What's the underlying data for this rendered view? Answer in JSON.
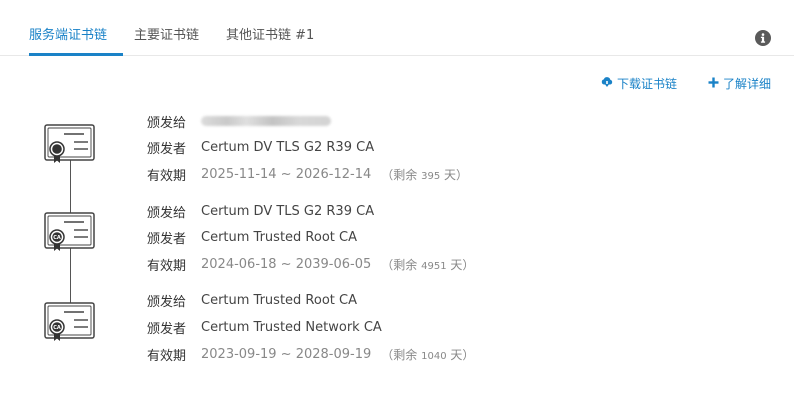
{
  "tabs": [
    {
      "label": "服务端证书链",
      "active": true
    },
    {
      "label": "主要证书链",
      "active": false
    },
    {
      "label": "其他证书链 #1",
      "active": false
    }
  ],
  "actions": {
    "download": "下载证书链",
    "details": "了解详细"
  },
  "labels": {
    "issued_to": "颁发给",
    "issuer": "颁发者",
    "validity": "有效期",
    "remaining_prefix": "（剩余",
    "remaining_suffix": "天）"
  },
  "certificates": [
    {
      "issued_to": "",
      "issued_to_redacted": true,
      "issuer": "Certum DV TLS G2 R39 CA",
      "validity": "2025-11-14 ~ 2026-12-14",
      "remaining_days": "395",
      "icon": "certificate-seal-icon"
    },
    {
      "issued_to": "Certum DV TLS G2 R39 CA",
      "issuer": "Certum Trusted Root CA",
      "validity": "2024-06-18 ~ 2039-06-05",
      "remaining_days": "4951",
      "icon": "certificate-ca-icon"
    },
    {
      "issued_to": "Certum Trusted Root CA",
      "issuer": "Certum Trusted Network CA",
      "validity": "2023-09-19 ~ 2028-09-19",
      "remaining_days": "1040",
      "icon": "certificate-ca-icon"
    }
  ],
  "colors": {
    "accent": "#1a82c7",
    "text": "#333333",
    "muted": "#888888"
  }
}
